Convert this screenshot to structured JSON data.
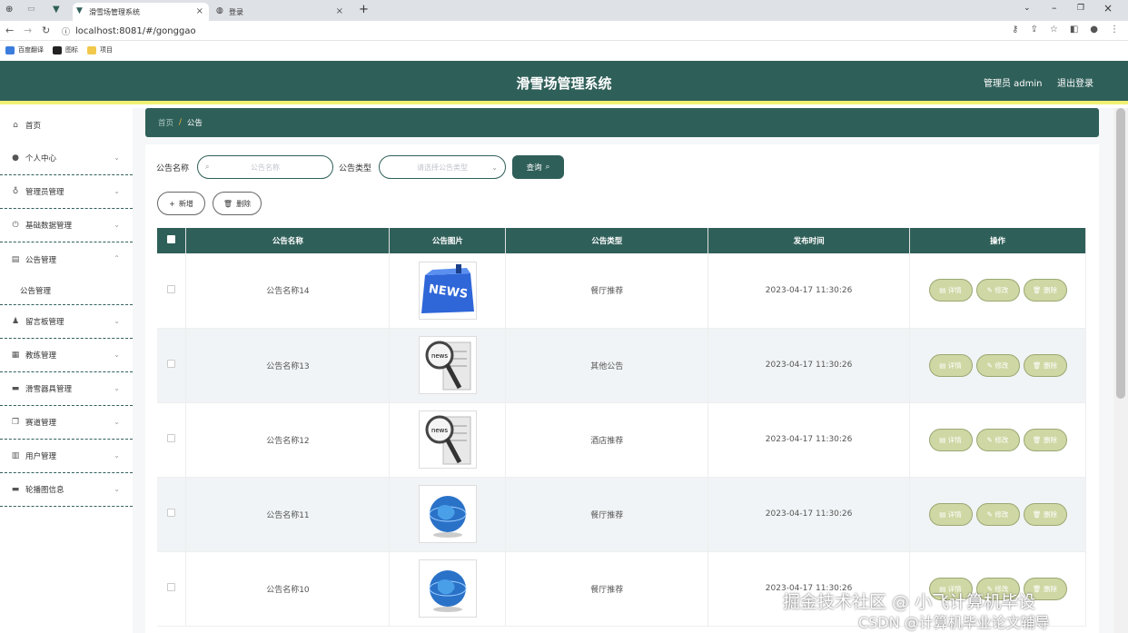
{
  "browser": {
    "tabs": [
      {
        "title": "滑雪场管理系统"
      },
      {
        "title": "登录"
      }
    ],
    "url": "localhost:8081/#/gonggao",
    "bookmarks": [
      "百度翻译",
      "图标",
      "项目"
    ]
  },
  "header": {
    "title": "滑雪场管理系统",
    "user": "管理员 admin",
    "logout": "退出登录"
  },
  "sidebar": {
    "items": [
      {
        "label": "首页",
        "icon": "home-icon"
      },
      {
        "label": "个人中心",
        "icon": "user-icon"
      },
      {
        "label": "管理员管理",
        "icon": "mic-icon"
      },
      {
        "label": "基础数据管理",
        "icon": "power-icon"
      },
      {
        "label": "公告管理",
        "icon": "bank-icon"
      },
      {
        "label": "公告管理",
        "icon": ""
      },
      {
        "label": "留言板管理",
        "icon": "user-icon"
      },
      {
        "label": "教练管理",
        "icon": "chart-icon"
      },
      {
        "label": "滑雪器具管理",
        "icon": "monitor-icon"
      },
      {
        "label": "赛道管理",
        "icon": "copy-icon"
      },
      {
        "label": "用户管理",
        "icon": "doc-icon"
      },
      {
        "label": "轮播图信息",
        "icon": "monitor-icon"
      }
    ]
  },
  "breadcrumb": {
    "home": "首页",
    "current": "公告"
  },
  "search": {
    "name_label": "公告名称",
    "name_placeholder": "公告名称",
    "type_label": "公告类型",
    "type_placeholder": "请选择公告类型",
    "query": "查询"
  },
  "actions": {
    "add": "新增",
    "delete": "删除"
  },
  "table": {
    "headers": [
      "公告名称",
      "公告图片",
      "公告类型",
      "发布时间",
      "操作"
    ],
    "rows": [
      {
        "name": "公告名称14",
        "type": "餐厅推荐",
        "time": "2023-04-17 11:30:26",
        "image": "news-key"
      },
      {
        "name": "公告名称13",
        "type": "其他公告",
        "time": "2023-04-17 11:30:26",
        "image": "news-magnifier"
      },
      {
        "name": "公告名称12",
        "type": "酒店推荐",
        "time": "2023-04-17 11:30:26",
        "image": "news-magnifier"
      },
      {
        "name": "公告名称11",
        "type": "餐厅推荐",
        "time": "2023-04-17 11:30:26",
        "image": "globe"
      },
      {
        "name": "公告名称10",
        "type": "餐厅推荐",
        "time": "2023-04-17 11:30:26",
        "image": "globe"
      }
    ],
    "ops": {
      "detail": "详情",
      "edit": "修改",
      "delete": "删除"
    }
  },
  "watermark": {
    "line1": "掘金技术社区 @ 小飞计算机毕设",
    "line2": "CSDN @计算机毕业论文辅导"
  },
  "colors": {
    "primary": "#2f5f59",
    "accent": "#f2f072",
    "op_button": "#cfd7a4"
  }
}
